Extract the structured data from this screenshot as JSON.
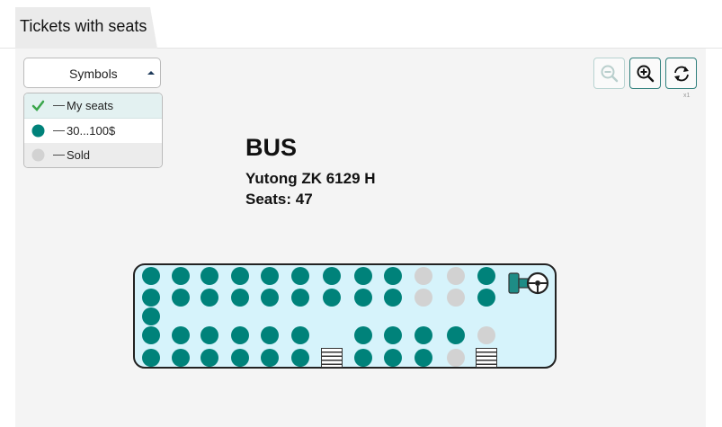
{
  "tab": {
    "label": "Tickets with seats"
  },
  "symbols": {
    "label": "Symbols"
  },
  "legend": [
    {
      "icon": "checkmark-icon",
      "dash": "—",
      "label": "My seats"
    },
    {
      "icon": "available-seat-icon",
      "dash": "—",
      "label": "30...100$"
    },
    {
      "icon": "sold-seat-icon",
      "dash": "—",
      "label": "Sold"
    }
  ],
  "toolbar": {
    "zoom_out": "zoom-out-icon",
    "zoom_in": "zoom-in-icon",
    "reset": "refresh-icon",
    "zoom_level": "x1"
  },
  "vehicle": {
    "type": "BUS",
    "model": "Yutong ZK 6129 H",
    "seats_label": "Seats: 47"
  },
  "colors": {
    "available": "#00827a",
    "sold": "#d2d2d2",
    "bus_fill": "#d6f3fb",
    "accent": "#2f7f7c",
    "check": "#3aa64b"
  },
  "seat_map": {
    "columns": 12,
    "rows": [
      [
        "available",
        "available",
        "available",
        "available",
        "available",
        "available",
        "available",
        "available",
        "available",
        "sold",
        "sold",
        "available"
      ],
      [
        "available",
        "available",
        "available",
        "available",
        "available",
        "available",
        "available",
        "available",
        "available",
        "sold",
        "sold",
        "available"
      ],
      [
        "available",
        "empty",
        "empty",
        "empty",
        "empty",
        "empty",
        "empty",
        "empty",
        "empty",
        "empty",
        "empty",
        "empty"
      ],
      [
        "available",
        "available",
        "available",
        "available",
        "available",
        "available",
        "empty",
        "available",
        "available",
        "available",
        "available",
        "sold"
      ],
      [
        "available",
        "available",
        "available",
        "available",
        "available",
        "available",
        "stairs",
        "available",
        "available",
        "available",
        "sold",
        "stairs"
      ]
    ]
  }
}
